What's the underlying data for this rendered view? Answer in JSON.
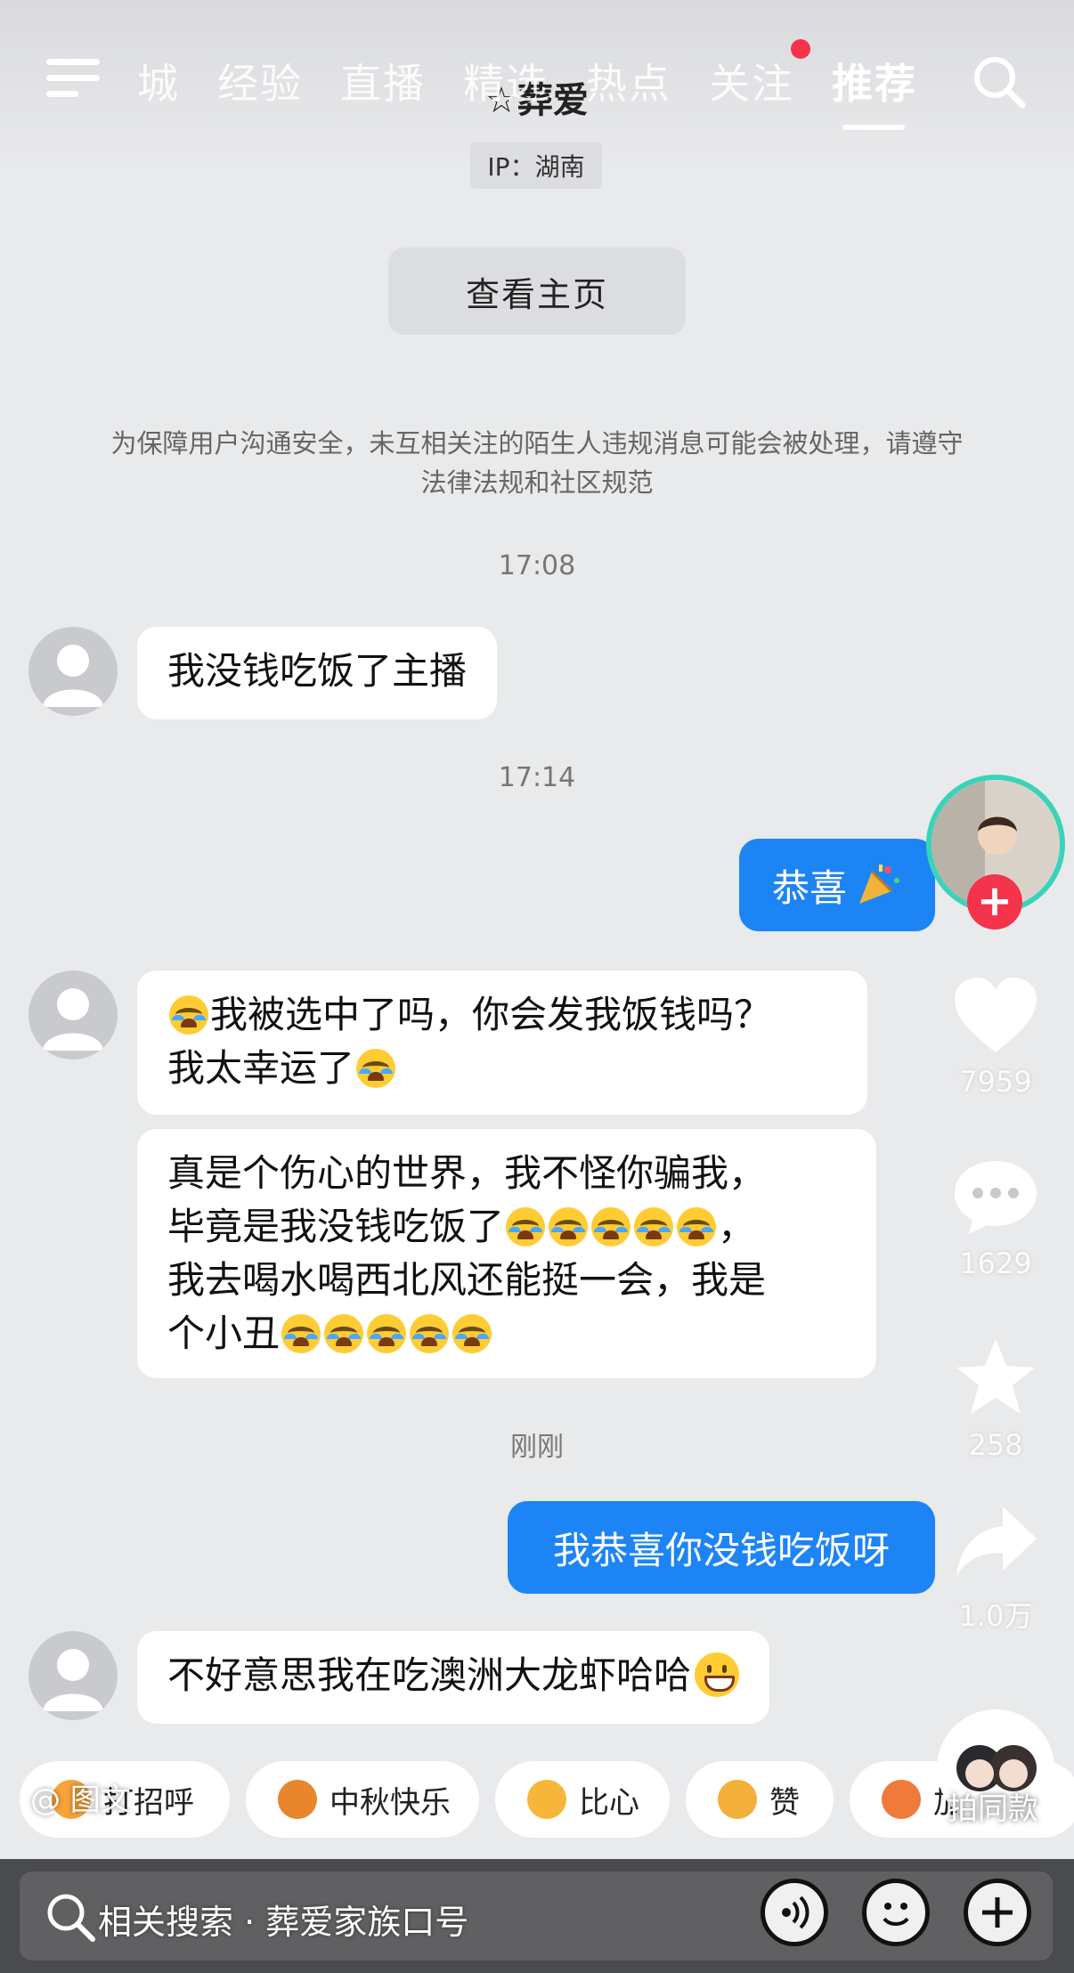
{
  "top_nav": {
    "tabs": [
      "城",
      "经验",
      "直播",
      "精选",
      "热点",
      "关注",
      "推荐"
    ],
    "active_tab": "推荐"
  },
  "chat": {
    "name": "☆葬爱",
    "ip_label": "IP：湖南",
    "view_home_label": "查看主页",
    "notice": "为保障用户沟通安全，未互相关注的陌生人违规消息可能会被处理，请遵守法律法规和社区规范",
    "messages": [
      {
        "time": "17:08"
      },
      {
        "side": "left",
        "text": "我没钱吃饭了主播"
      },
      {
        "time": "17:14"
      },
      {
        "side": "right",
        "text": "恭喜"
      },
      {
        "side": "left",
        "line1": "我被选中了吗，你会发我饭钱吗？",
        "line2": "我太幸运了"
      },
      {
        "side": "left",
        "line1": "真是个伤心的世界，我不怪你骗我，",
        "line2": "毕竟是我没钱吃饭了",
        "line2_tail": "，",
        "line3": "我去喝水喝西北风还能挺一会，我是",
        "line4": "个小丑"
      },
      {
        "time": "刚刚"
      },
      {
        "side": "right",
        "text": "我恭喜你没钱吃饭呀"
      },
      {
        "side": "left",
        "text": "不好意思我在吃澳洲大龙虾哈哈"
      }
    ]
  },
  "side_actions": {
    "likes": "7959",
    "comments": "1629",
    "favorites": "258",
    "shares": "1.0万",
    "follow_symbol": "+"
  },
  "quick_replies": [
    "打招呼",
    "中秋快乐",
    "比心",
    "赞",
    "加油"
  ],
  "overlay": {
    "image_text": "@ 图文",
    "same_style": "拍同款",
    "related_search": "相关搜索 · 葬爱家族口号"
  },
  "colors": {
    "sent_bubble": "#1d84f5",
    "received_bubble": "#ffffff",
    "background": "#e9eaec",
    "badge_red": "#f5334b"
  }
}
